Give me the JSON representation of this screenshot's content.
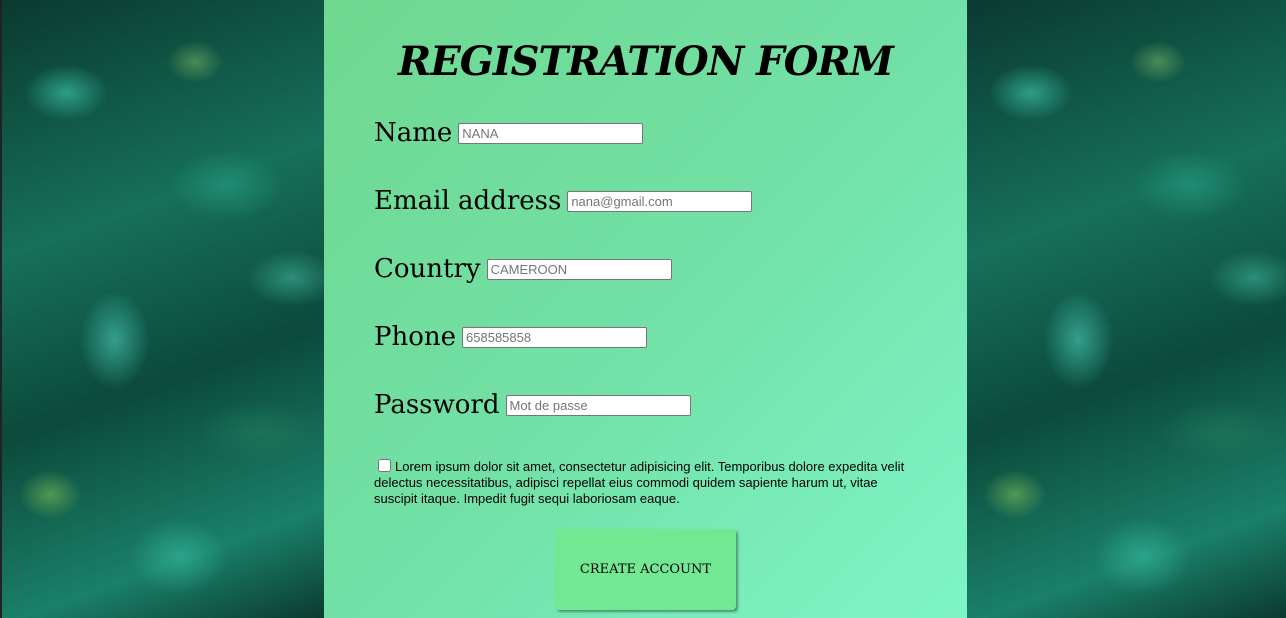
{
  "form": {
    "title": "REGISTRATION FORM",
    "fields": [
      {
        "label": "Name",
        "placeholder": "NANA"
      },
      {
        "label": "Email address",
        "placeholder": "nana@gmail.com"
      },
      {
        "label": "Country",
        "placeholder": "CAMEROON"
      },
      {
        "label": "Phone",
        "placeholder": "658585858"
      },
      {
        "label": "Password",
        "placeholder": "Mot de passe"
      }
    ],
    "terms_text": "Lorem ipsum dolor sit amet, consectetur adipisicing elit. Temporibus dolore expedita velit delectus necessitatibus, adipisci repellat eius commodi quidem sapiente harum ut, vitae suscipit itaque. Impedit fugit sequi laboriosam eaque.",
    "terms_checked": false,
    "submit_label": "CREATE ACCOUNT"
  },
  "colors": {
    "panel_start": "#6fd890",
    "panel_end": "#7ef5c8",
    "button": "#72e893"
  }
}
